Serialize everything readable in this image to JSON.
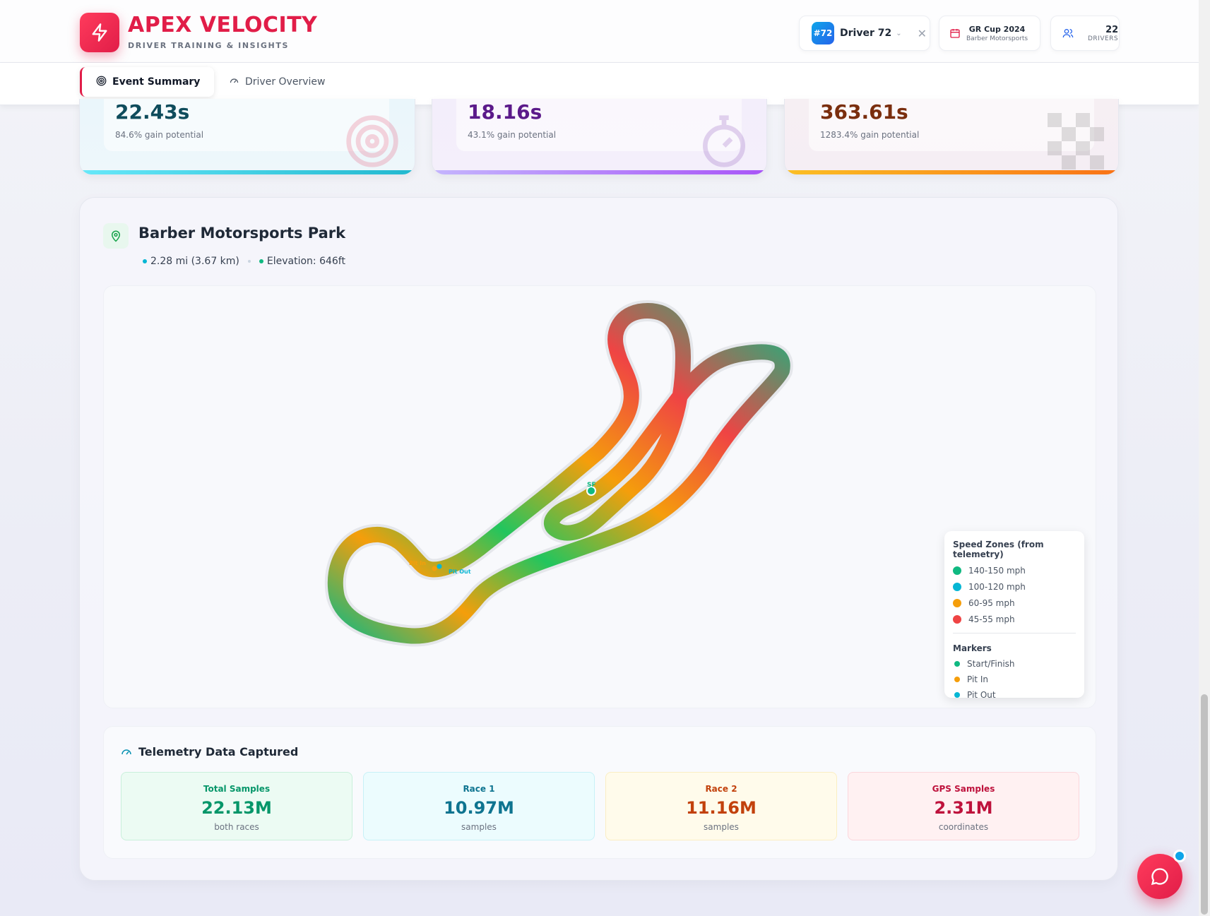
{
  "brand": {
    "title": "APEX VELOCITY",
    "subtitle": "DRIVER TRAINING & INSIGHTS"
  },
  "header": {
    "driver": {
      "number": "#72",
      "name": "Driver 72"
    },
    "event": {
      "name": "GR Cup 2024",
      "venue": "Barber Motorsports"
    },
    "drivers": {
      "count": "22",
      "label": "DRIVERS"
    }
  },
  "tabs": [
    {
      "label": "Event Summary",
      "active": true
    },
    {
      "label": "Driver Overview",
      "active": false
    }
  ],
  "stats": [
    {
      "value": "22.43s",
      "sub": "84.6% gain potential",
      "color": "#0f4c5c"
    },
    {
      "value": "18.16s",
      "sub": "43.1% gain potential",
      "color": "#5b1a8a"
    },
    {
      "value": "363.61s",
      "sub": "1283.4% gain potential",
      "color": "#7a2e0e"
    }
  ],
  "track": {
    "name": "Barber Motorsports Park",
    "length": "2.28 mi (3.67 km)",
    "elevation": "Elevation: 646ft",
    "markers": {
      "sf": "SF",
      "pit_in": "Pit In",
      "pit_out": "Pit Out"
    }
  },
  "legend": {
    "speed_title": "Speed Zones (from telemetry)",
    "speed_zones": [
      {
        "label": "140-150 mph",
        "color": "#10b981"
      },
      {
        "label": "100-120 mph",
        "color": "#06b6d4"
      },
      {
        "label": "60-95 mph",
        "color": "#f59e0b"
      },
      {
        "label": "45-55 mph",
        "color": "#ef4444"
      }
    ],
    "markers_title": "Markers",
    "markers": [
      {
        "label": "Start/Finish",
        "color": "#10b981"
      },
      {
        "label": "Pit In",
        "color": "#f59e0b"
      },
      {
        "label": "Pit Out",
        "color": "#06b6d4"
      }
    ]
  },
  "telemetry": {
    "title": "Telemetry Data Captured",
    "cards": [
      {
        "label": "Total Samples",
        "value": "22.13M",
        "sub": "both races",
        "color": "#059669",
        "bg": "#ecfbf3",
        "border": "#c9f0db"
      },
      {
        "label": "Race 1",
        "value": "10.97M",
        "sub": "samples",
        "color": "#0e7490",
        "bg": "#ecfcfe",
        "border": "#c8f1f7"
      },
      {
        "label": "Race 2",
        "value": "11.16M",
        "sub": "samples",
        "color": "#c2410c",
        "bg": "#fffbeb",
        "border": "#fbeec3"
      },
      {
        "label": "GPS Samples",
        "value": "2.31M",
        "sub": "coordinates",
        "color": "#be123c",
        "bg": "#fff1f2",
        "border": "#fbd6dc"
      }
    ]
  }
}
